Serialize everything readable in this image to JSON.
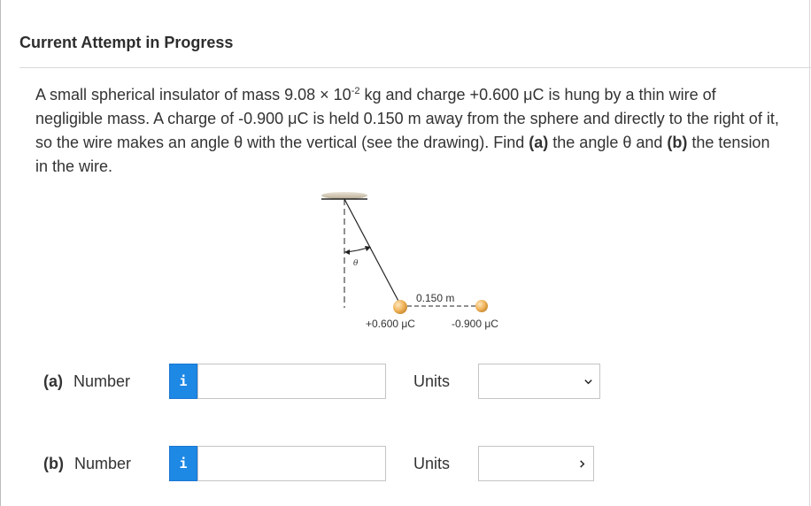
{
  "header": {
    "title": "Current Attempt in Progress"
  },
  "question": {
    "p1": "A small spherical insulator of mass 9.08 × 10",
    "exp": "-2",
    "p2": " kg and charge +0.600 μC is hung by a thin wire of negligible mass. A charge of -0.900 μC is held 0.150 m away from the sphere and directly to the right of it, so the wire makes an angle θ with the vertical (see the drawing). Find ",
    "part_a": "(a)",
    "p3": " the angle θ and ",
    "part_b": "(b)",
    "p4": " the tension in the wire."
  },
  "diagram": {
    "theta": "θ",
    "distance": "0.150 m",
    "charge_left": "+0.600 μC",
    "charge_right": "-0.900 μC"
  },
  "answers": [
    {
      "part": "(a)",
      "label": "Number",
      "info": "i",
      "value": "",
      "units_label": "Units",
      "units_value": ""
    },
    {
      "part": "(b)",
      "label": "Number",
      "info": "i",
      "value": "",
      "units_label": "Units",
      "units_value": ""
    }
  ],
  "colors": {
    "info_button": "#1e88e5",
    "sphere": "#f0b35a"
  }
}
